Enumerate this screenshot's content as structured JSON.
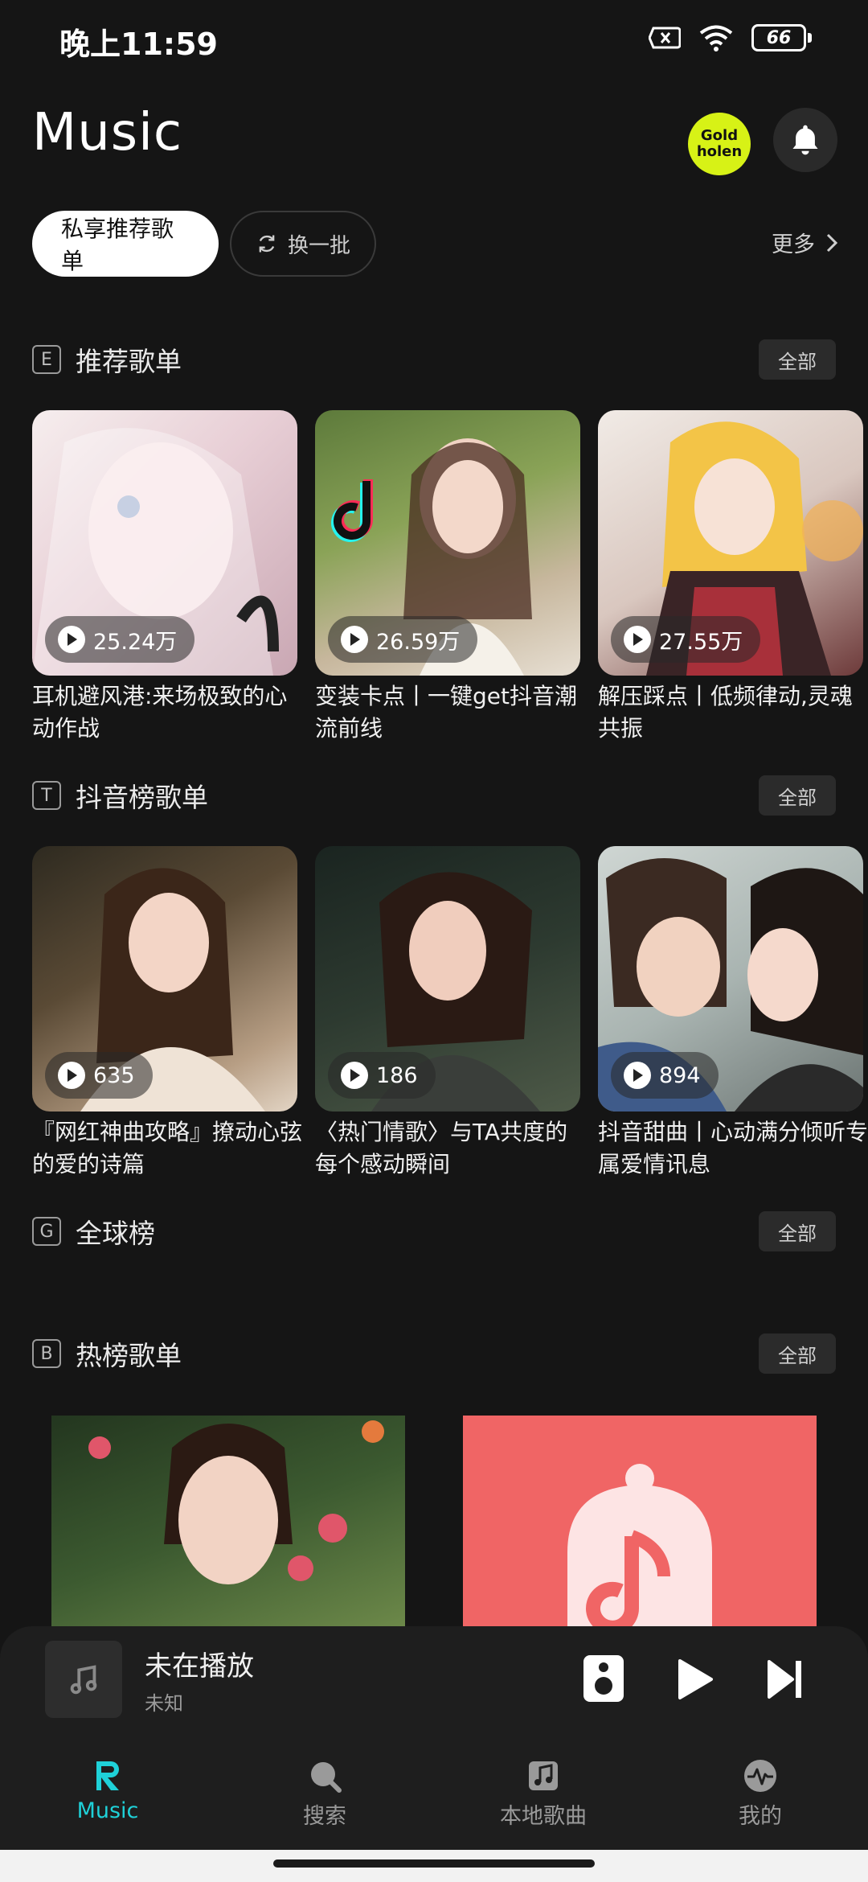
{
  "status": {
    "time": "晚上11:59",
    "battery": "66"
  },
  "header": {
    "title": "Music",
    "badge": "Gold holen"
  },
  "chips": {
    "active": "私享推荐歌单",
    "refresh": "换一批",
    "more": "更多"
  },
  "sections": [
    {
      "letter": "E",
      "title": "推荐歌单",
      "all": "全部"
    },
    {
      "letter": "T",
      "title": "抖音榜歌单",
      "all": "全部"
    },
    {
      "letter": "G",
      "title": "全球榜",
      "all": "全部"
    },
    {
      "letter": "B",
      "title": "热榜歌单",
      "all": "全部"
    }
  ],
  "recommended": [
    {
      "plays": "25.24万",
      "title": "耳机避风港:来场极致的心动作战"
    },
    {
      "plays": "26.59万",
      "title": "变装卡点丨一键get抖音潮流前线"
    },
    {
      "plays": "27.55万",
      "title": "解压踩点丨低频律动,灵魂共振"
    }
  ],
  "douyin": [
    {
      "plays": "635",
      "title": "『网红神曲攻略』撩动心弦的爱的诗篇"
    },
    {
      "plays": "186",
      "title": "〈热门情歌〉与TA共度的每个感动瞬间"
    },
    {
      "plays": "894",
      "title": "抖音甜曲丨心动满分倾听专属爱情讯息"
    }
  ],
  "player": {
    "title": "未在播放",
    "artist": "未知"
  },
  "nav": [
    {
      "label": "Music",
      "icon": "r-logo-icon"
    },
    {
      "label": "搜索",
      "icon": "search-icon"
    },
    {
      "label": "本地歌曲",
      "icon": "local-music-icon"
    },
    {
      "label": "我的",
      "icon": "pulse-icon"
    }
  ],
  "colors": {
    "accent": "#1fd1d8",
    "badge": "#d7f216",
    "background": "#151515"
  }
}
